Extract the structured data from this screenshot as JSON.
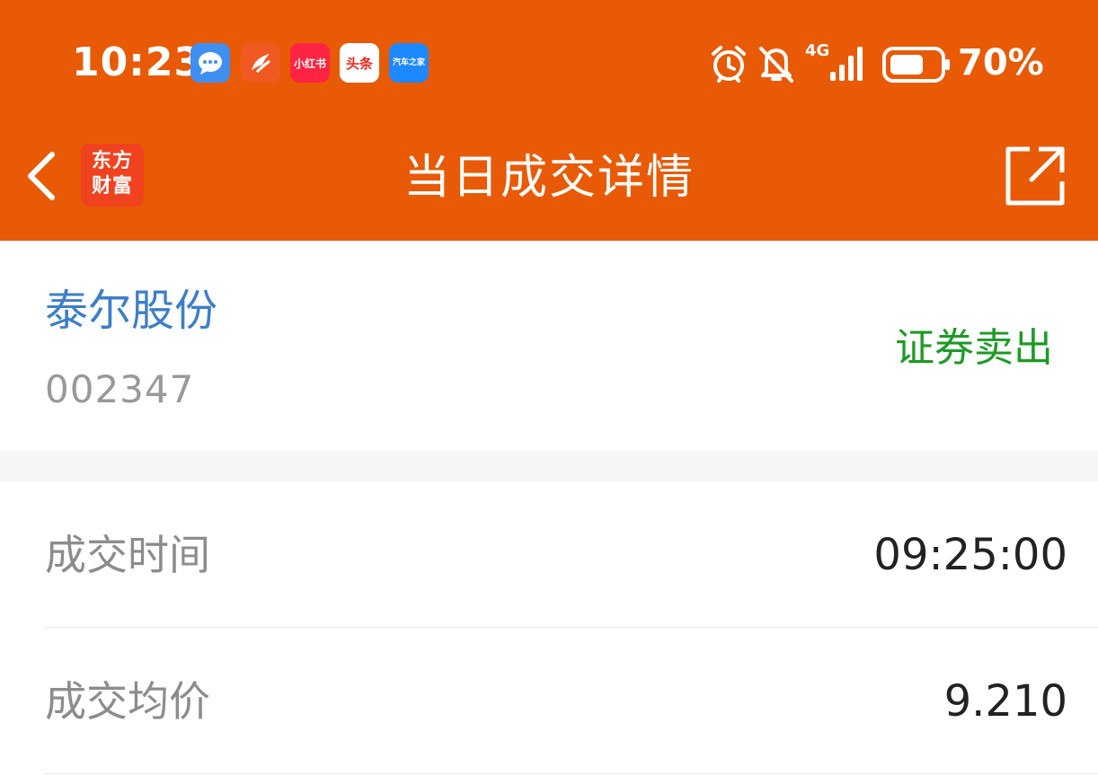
{
  "status_bar": {
    "time": "10:23",
    "notifications": [
      {
        "name": "messages-app-icon",
        "label": ""
      },
      {
        "name": "feishu-app-icon",
        "label": ""
      },
      {
        "name": "xiaohongshu-app-icon",
        "label": "小红书"
      },
      {
        "name": "toutiao-app-icon",
        "label": "头条"
      },
      {
        "name": "autohome-app-icon",
        "label": "汽车之家"
      }
    ],
    "network": "4G",
    "battery": "70%"
  },
  "nav": {
    "logo_line1": "东方",
    "logo_line2": "财富",
    "title": "当日成交详情"
  },
  "stock": {
    "name": "泰尔股份",
    "code": "002347",
    "trade_type": "证券卖出"
  },
  "details": [
    {
      "label": "成交时间",
      "value": "09:25:00"
    },
    {
      "label": "成交均价",
      "value": "9.210"
    }
  ],
  "colors": {
    "header": "#e85a05",
    "stock_name": "#3d7ec8",
    "sell": "#1e9a26"
  }
}
